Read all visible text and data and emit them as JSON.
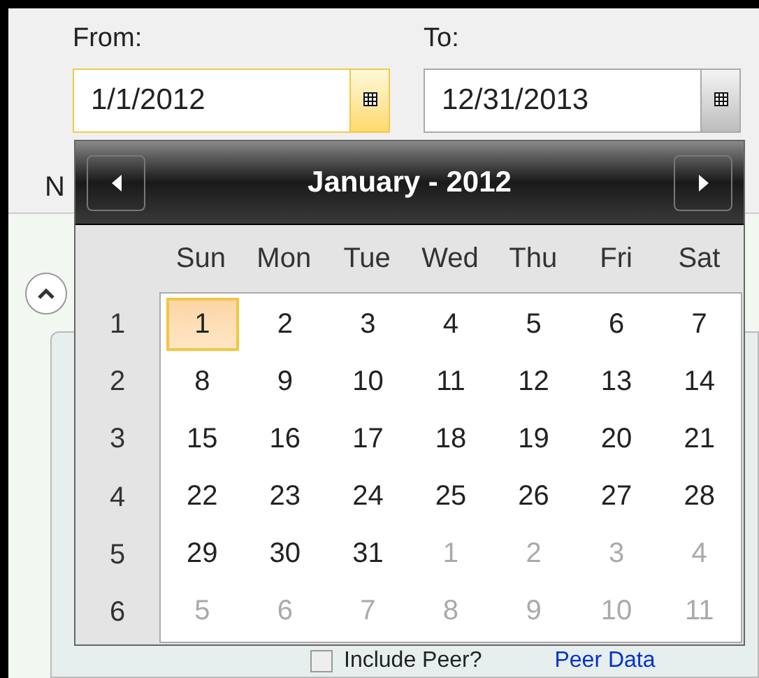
{
  "from": {
    "label": "From:",
    "value": "1/1/2012",
    "focused": true
  },
  "to": {
    "label": "To:",
    "value": "12/31/2013",
    "focused": false
  },
  "behind": {
    "label": "N",
    "checkbox": {
      "label": "Include Peer?",
      "checked": false
    },
    "link": "Peer Data"
  },
  "calendar": {
    "title": "January - 2012",
    "weekdays": [
      "Sun",
      "Mon",
      "Tue",
      "Wed",
      "Thu",
      "Fri",
      "Sat"
    ],
    "weeks": [
      {
        "number": "1",
        "days": [
          {
            "text": "1",
            "in_month": true,
            "selected": true
          },
          {
            "text": "2",
            "in_month": true,
            "selected": false
          },
          {
            "text": "3",
            "in_month": true,
            "selected": false
          },
          {
            "text": "4",
            "in_month": true,
            "selected": false
          },
          {
            "text": "5",
            "in_month": true,
            "selected": false
          },
          {
            "text": "6",
            "in_month": true,
            "selected": false
          },
          {
            "text": "7",
            "in_month": true,
            "selected": false
          }
        ]
      },
      {
        "number": "2",
        "days": [
          {
            "text": "8",
            "in_month": true,
            "selected": false
          },
          {
            "text": "9",
            "in_month": true,
            "selected": false
          },
          {
            "text": "10",
            "in_month": true,
            "selected": false
          },
          {
            "text": "11",
            "in_month": true,
            "selected": false
          },
          {
            "text": "12",
            "in_month": true,
            "selected": false
          },
          {
            "text": "13",
            "in_month": true,
            "selected": false
          },
          {
            "text": "14",
            "in_month": true,
            "selected": false
          }
        ]
      },
      {
        "number": "3",
        "days": [
          {
            "text": "15",
            "in_month": true,
            "selected": false
          },
          {
            "text": "16",
            "in_month": true,
            "selected": false
          },
          {
            "text": "17",
            "in_month": true,
            "selected": false
          },
          {
            "text": "18",
            "in_month": true,
            "selected": false
          },
          {
            "text": "19",
            "in_month": true,
            "selected": false
          },
          {
            "text": "20",
            "in_month": true,
            "selected": false
          },
          {
            "text": "21",
            "in_month": true,
            "selected": false
          }
        ]
      },
      {
        "number": "4",
        "days": [
          {
            "text": "22",
            "in_month": true,
            "selected": false
          },
          {
            "text": "23",
            "in_month": true,
            "selected": false
          },
          {
            "text": "24",
            "in_month": true,
            "selected": false
          },
          {
            "text": "25",
            "in_month": true,
            "selected": false
          },
          {
            "text": "26",
            "in_month": true,
            "selected": false
          },
          {
            "text": "27",
            "in_month": true,
            "selected": false
          },
          {
            "text": "28",
            "in_month": true,
            "selected": false
          }
        ]
      },
      {
        "number": "5",
        "days": [
          {
            "text": "29",
            "in_month": true,
            "selected": false
          },
          {
            "text": "30",
            "in_month": true,
            "selected": false
          },
          {
            "text": "31",
            "in_month": true,
            "selected": false
          },
          {
            "text": "1",
            "in_month": false,
            "selected": false
          },
          {
            "text": "2",
            "in_month": false,
            "selected": false
          },
          {
            "text": "3",
            "in_month": false,
            "selected": false
          },
          {
            "text": "4",
            "in_month": false,
            "selected": false
          }
        ]
      },
      {
        "number": "6",
        "days": [
          {
            "text": "5",
            "in_month": false,
            "selected": false
          },
          {
            "text": "6",
            "in_month": false,
            "selected": false
          },
          {
            "text": "7",
            "in_month": false,
            "selected": false
          },
          {
            "text": "8",
            "in_month": false,
            "selected": false
          },
          {
            "text": "9",
            "in_month": false,
            "selected": false
          },
          {
            "text": "10",
            "in_month": false,
            "selected": false
          },
          {
            "text": "11",
            "in_month": false,
            "selected": false
          }
        ]
      }
    ]
  }
}
